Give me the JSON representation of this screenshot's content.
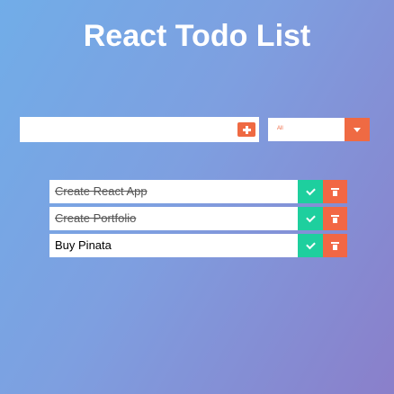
{
  "header": {
    "title": "React Todo List"
  },
  "form": {
    "input_value": "",
    "input_placeholder": "",
    "add_icon": "plus-square-icon",
    "filter": {
      "selected": "All",
      "arrow_icon": "chevron-down-icon"
    }
  },
  "todos": [
    {
      "text": "Create React App",
      "completed": true
    },
    {
      "text": "Create Portfolio",
      "completed": true
    },
    {
      "text": "Buy Pinata",
      "completed": false
    }
  ],
  "colors": {
    "accent": "#ef6a43",
    "complete": "#1ecf9e",
    "delete": "#f26744",
    "background_start": "#71ade8",
    "background_end": "#8a7fca"
  },
  "icons": {
    "complete": "check-icon",
    "delete": "trash-icon"
  }
}
